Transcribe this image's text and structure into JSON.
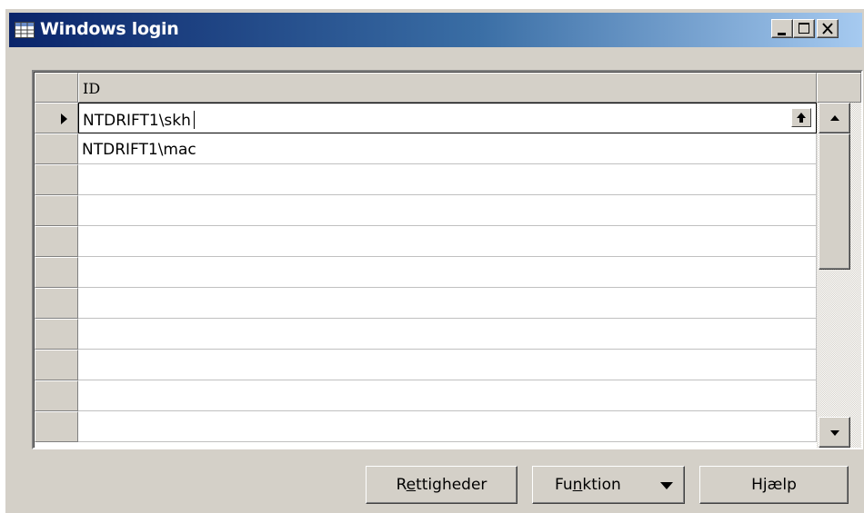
{
  "window": {
    "title": "Windows login",
    "icon": "table-icon"
  },
  "grid": {
    "column_header": "ID",
    "rows": [
      {
        "id": "NTDRIFT1\\skh",
        "active": true
      },
      {
        "id": "NTDRIFT1\\mac",
        "active": false
      },
      {
        "id": "",
        "active": false
      },
      {
        "id": "",
        "active": false
      },
      {
        "id": "",
        "active": false
      },
      {
        "id": "",
        "active": false
      },
      {
        "id": "",
        "active": false
      },
      {
        "id": "",
        "active": false
      },
      {
        "id": "",
        "active": false
      },
      {
        "id": "",
        "active": false
      },
      {
        "id": "",
        "active": false
      }
    ]
  },
  "buttons": {
    "rettigheder": {
      "pre": "R",
      "accel": "e",
      "post": "ttigheder"
    },
    "funktion": {
      "pre": "Fu",
      "accel": "n",
      "post": "ktion"
    },
    "hjaelp": {
      "label": "Hjælp"
    }
  },
  "colors": {
    "title_start": "#0a246a",
    "title_end": "#a6caf0",
    "face": "#d4d0c8"
  }
}
